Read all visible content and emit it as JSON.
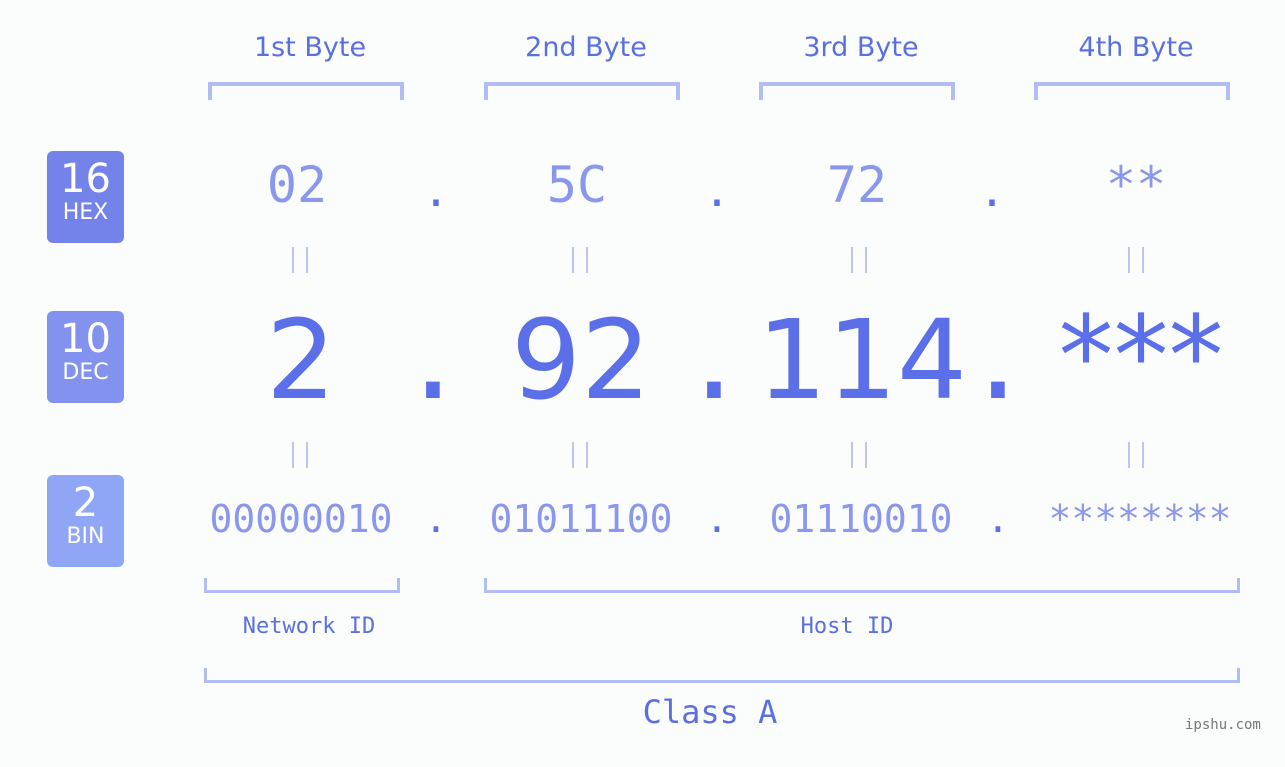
{
  "bytes": [
    {
      "label": "1st Byte",
      "hex": "02",
      "dec": "2",
      "bin": "00000010"
    },
    {
      "label": "2nd Byte",
      "hex": "5C",
      "dec": "92",
      "bin": "01011100"
    },
    {
      "label": "3rd Byte",
      "hex": "72",
      "dec": "114",
      "bin": "01110010"
    },
    {
      "label": "4th Byte",
      "hex": "**",
      "dec": "***",
      "bin": "********"
    }
  ],
  "separator": ".",
  "badges": {
    "hex": {
      "num": "16",
      "label": "HEX",
      "color": "#7383ea"
    },
    "dec": {
      "num": "10",
      "label": "DEC",
      "color": "#8392ef"
    },
    "bin": {
      "num": "2",
      "label": "BIN",
      "color": "#8fa6f6"
    }
  },
  "network_id_label": "Network ID",
  "host_id_label": "Host ID",
  "class_label": "Class A",
  "watermark": "ipshu.com"
}
